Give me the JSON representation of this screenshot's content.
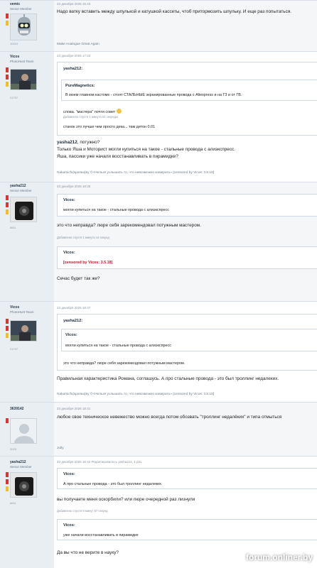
{
  "watermark": "forum.onliner.by",
  "posts": [
    {
      "user": {
        "name": "vemic",
        "title": "Senior Member",
        "count": "10010"
      },
      "date": "23 декабря 2025 15:43",
      "text": "Надо ватку вставить между шпулькой и катушкой кассеты, чтоб притормозить шпульку. И еще раз попытаться.",
      "signature": "Make Analogue Great Again"
    },
    {
      "user": {
        "name": "Vicos",
        "title": "PhotoHunt Team",
        "count": "21797"
      },
      "date": "23 декабря 2025 17:22",
      "quote_outer_author": "yasha212:",
      "quote_inner_author": "PureMagnetics:",
      "quote_inner_text": "В моем главном кастоме - стоят СТАЛЬНЫЕ экранированные провода с Aliexpress и на ГЗ и от ГВ.",
      "quote_line1": "слова. \"мастера\" почти совет",
      "quote_added": "Добавлено спустя 1 минута 54 секунды",
      "quote_line2": "станок это лучше чем просто дека... там детон 0.01",
      "reply_name": "yasha212",
      "reply_line1": ", потужно?",
      "reply_line2": "Только Яша и Моторист могли купиться на такое - стальные провода с алиэкспресс.",
      "reply_line3": "Яша, пассики уже начали восстанавливать в пирамидке?",
      "signature": "Nakamichi(кропка)by ©«Нельзя услышать то, что невозможно измерить» [censored by Vicos: 3.5.18]"
    },
    {
      "user": {
        "name": "yasha212",
        "title": "Senior Member",
        "count": "6611"
      },
      "date": "23 декабря 2025 18:35",
      "quote1_author": "Vicos:",
      "quote1_text": "могли купиться на такое - стальные провода с алиэкспресс",
      "text1": "это что неправда? люре себя зарекомендовал потужным мастером.",
      "added": "Добавлено спустя 1 минута 14 секунд",
      "quote2_author": "Vicos:",
      "quote2_text": "[censored by Vicos: 3.5.18]",
      "text2": "Сечас будет так же?"
    },
    {
      "user": {
        "name": "Vicos",
        "title": "PhotoHunt Team",
        "count": "21797"
      },
      "date": "23 декабря 2025 18:37",
      "quote_outer_author": "yasha212:",
      "quote_inner_author": "Vicos:",
      "quote_inner_text": "могли купиться на такое - стальные провода с алиэкспресс",
      "quote_line": "это что неправда? люре себя зарекомендовал потужным мастером.",
      "text": "Правильная характеристика Романа, соглашусь. А про стальные провода - это был троллинг недалеких.",
      "signature": "Nakamichi(кропка)by ©«Нельзя услышать то, что невозможно измерить» [censored by Vicos: 3.5.18]"
    },
    {
      "user": {
        "name": "3639142",
        "title": "",
        "count": "2023"
      },
      "date": "23 декабря 2025 18:41",
      "text": "любое свое техническое невежество можно всегда потом обозвать \"троллинг недалёких\" и типа отмыться",
      "signature": "Jully"
    },
    {
      "user": {
        "name": "yasha212",
        "title": "Senior Member",
        "count": "6611"
      },
      "date": "23 декабря 2025 18:42",
      "edited": "Редактировалось yasha212, 1 раз.",
      "quote1_author": "Vicos:",
      "quote1_text": "А про стальные провода - это был троллинг недалеких.",
      "text1": "вы получаете меня оскорбили? или пюре очередной раз лизнули",
      "added": "Добавлено спустя 8 минут 57 секунд",
      "quote2_author": "Vicos:",
      "quote2_text": "уже начали восстанавливать в пирамидке",
      "text2": "Да вы что не верите в науку?"
    }
  ]
}
